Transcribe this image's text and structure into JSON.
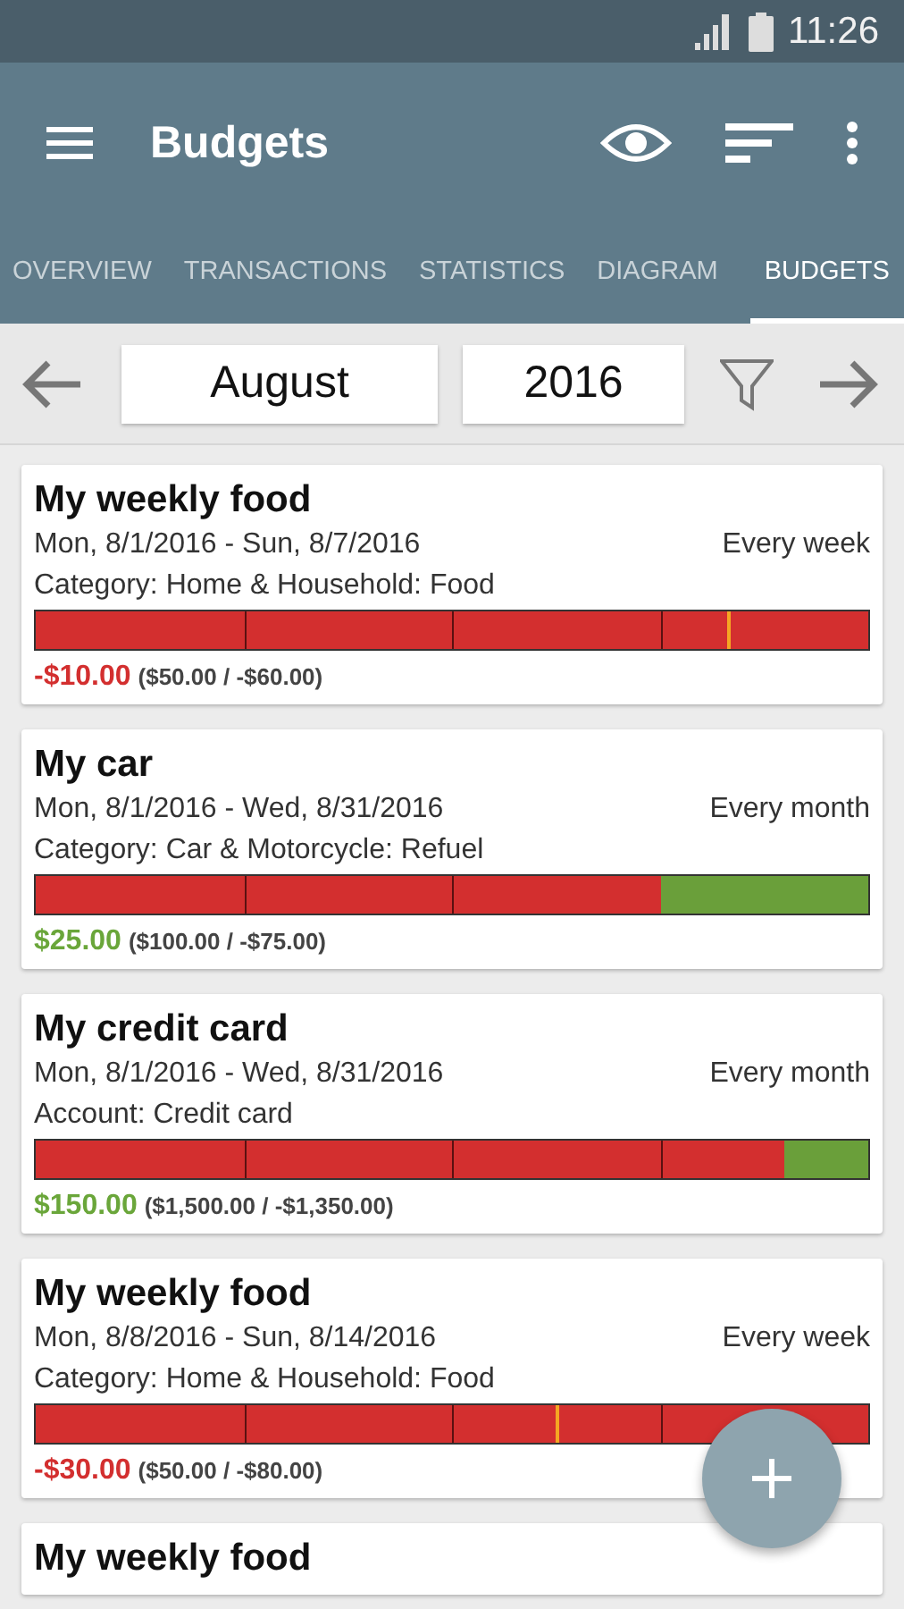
{
  "status_bar": {
    "time": "11:26"
  },
  "toolbar": {
    "title": "Budgets"
  },
  "tabs": [
    {
      "label": "OVERVIEW",
      "selected": false
    },
    {
      "label": "TRANSACTIONS",
      "selected": false
    },
    {
      "label": "STATISTICS",
      "selected": false
    },
    {
      "label": "DIAGRAM",
      "selected": false
    },
    {
      "label": "BUDGETS",
      "selected": true
    }
  ],
  "period": {
    "month": "August",
    "year": "2016"
  },
  "budgets": [
    {
      "title": "My weekly food",
      "dates": "Mon, 8/1/2016 - Sun, 8/7/2016",
      "repeat": "Every week",
      "scope": "Category: Home & Household: Food",
      "spent": {
        "level": 1
      },
      "marker": {
        "level": 0.83
      },
      "over_budget": true,
      "remaining": "-$10.00",
      "detail": "($50.00 / -$60.00)"
    },
    {
      "title": "My car",
      "dates": "Mon, 8/1/2016 - Wed, 8/31/2016",
      "repeat": "Every month",
      "scope": "Category: Car & Motorcycle: Refuel",
      "spent": {
        "level": 0.75
      },
      "over_budget": false,
      "remaining": "$25.00",
      "detail": "($100.00 / -$75.00)"
    },
    {
      "title": "My credit card",
      "dates": "Mon, 8/1/2016 - Wed, 8/31/2016",
      "repeat": "Every month",
      "scope": "Account: Credit card",
      "spent": {
        "level": 0.9
      },
      "over_budget": false,
      "remaining": "$150.00",
      "detail": "($1,500.00 / -$1,350.00)"
    },
    {
      "title": "My weekly food",
      "dates": "Mon, 8/8/2016 - Sun, 8/14/2016",
      "repeat": "Every week",
      "scope": "Category: Home & Household: Food",
      "spent": {
        "level": 1
      },
      "marker": {
        "level": 0.625
      },
      "over_budget": true,
      "remaining": "-$30.00",
      "detail": "($50.00 / -$80.00)"
    },
    {
      "title": "My weekly food"
    }
  ]
}
